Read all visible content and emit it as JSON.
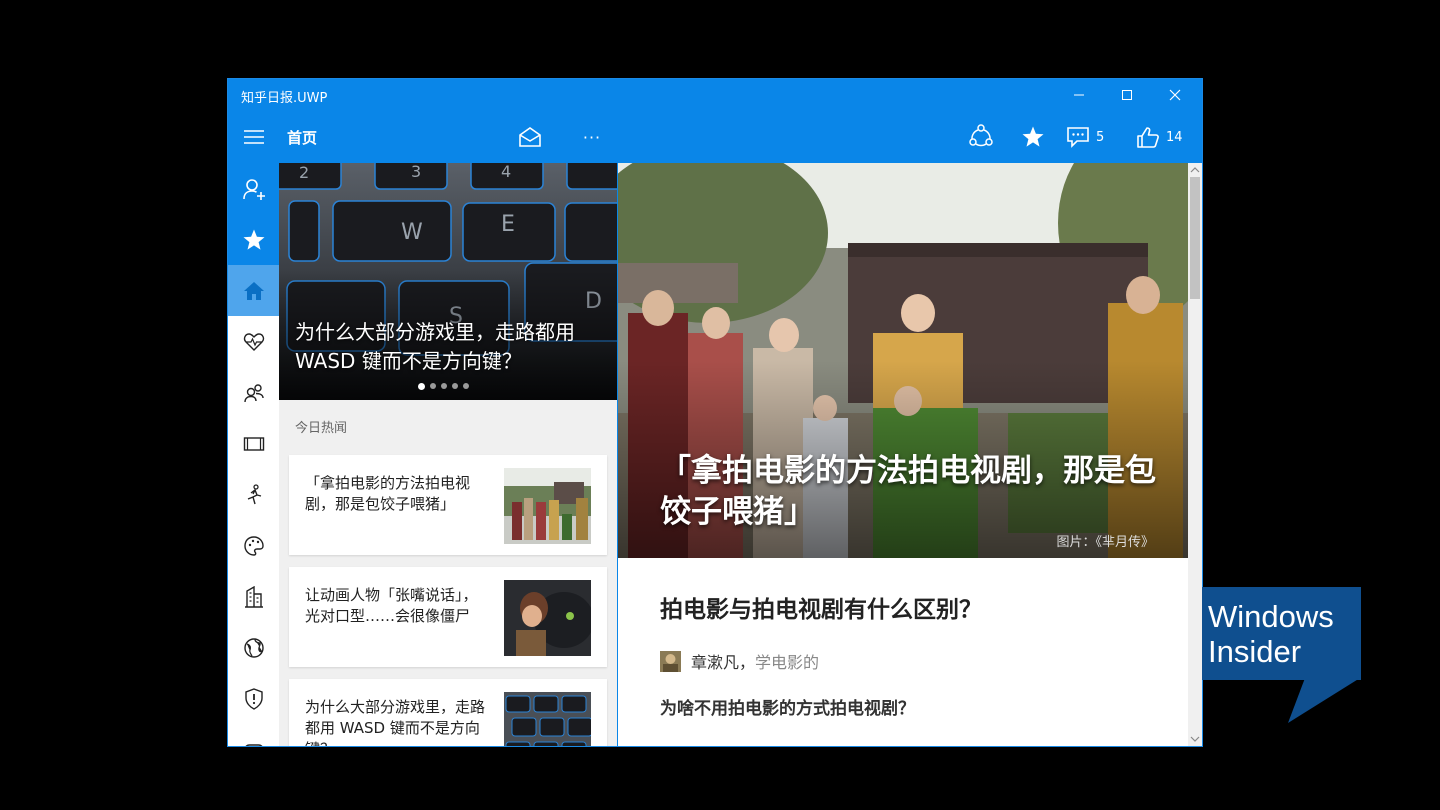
{
  "window": {
    "title": "知乎日报.UWP"
  },
  "commandbar": {
    "page_title": "首页",
    "more_label": "···",
    "comments_count": "5",
    "likes_count": "14"
  },
  "list": {
    "hero_title": "为什么大部分游戏里，走路都用 WASD 键而不是方向键？",
    "section_title": "今日热闻",
    "items": [
      {
        "title": "「拿拍电影的方法拍电视剧，那是包饺子喂猪」"
      },
      {
        "title": "让动画人物「张嘴说话」，光对口型……会很像僵尸"
      },
      {
        "title": "为什么大部分游戏里，走路都用 WASD 键而不是方向键？"
      }
    ]
  },
  "detail": {
    "hero_title": "「拿拍电影的方法拍电视剧，那是包饺子喂猪」",
    "image_credit": "图片：《芈月传》",
    "question_title": "拍电影与拍电视剧有什么区别？",
    "author_name": "章漱凡，",
    "author_bio": "学电影的",
    "answer_intro": "为啥不用拍电影的方式拍电视剧？"
  },
  "watermark": {
    "line1": "Windows",
    "line2": "Insider"
  },
  "colors": {
    "accent": "#0a86e8",
    "nav_selected": "#4fa5ec",
    "insider_bg": "#0f4f8f"
  }
}
